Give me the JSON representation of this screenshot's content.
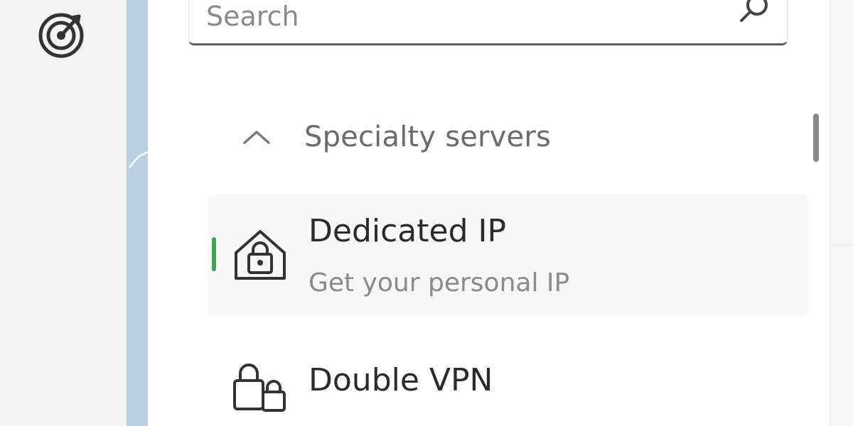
{
  "rail": {
    "icons": [
      {
        "name": "target-icon"
      }
    ]
  },
  "search": {
    "placeholder": "Search",
    "value": ""
  },
  "section": {
    "label": "Specialty servers",
    "expanded": true
  },
  "items": [
    {
      "title": "Dedicated IP",
      "subtitle": "Get your personal IP",
      "icon": "house-lock-icon",
      "selected": true
    },
    {
      "title": "Double VPN",
      "icon": "double-lock-icon",
      "selected": false
    }
  ],
  "colors": {
    "accent": "#3aa655",
    "map": "#b7cfe0",
    "text": "#2b2b2b",
    "muted": "#8a8a8a"
  }
}
